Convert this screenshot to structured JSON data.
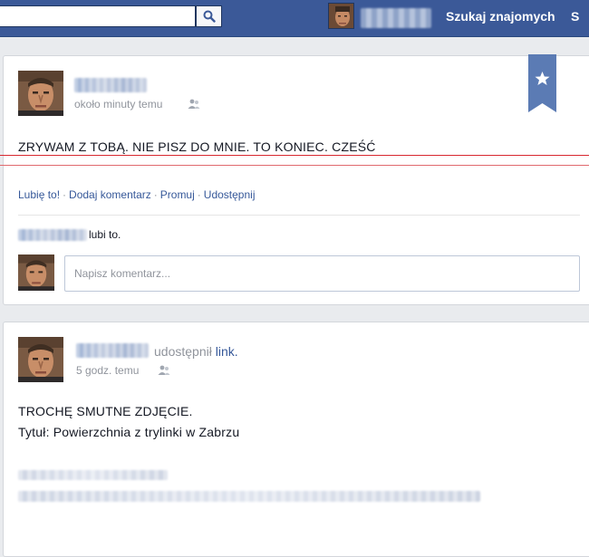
{
  "topbar": {
    "search": {
      "placeholder": "",
      "icon": "search-icon"
    },
    "find_friends_label": "Szukaj znajomych",
    "next_link_label": "S",
    "bg_color": "#3b5998"
  },
  "post1": {
    "time": "około minuty temu",
    "audience_icon": "friends-icon",
    "text": "ZRYWAM Z TOBĄ. NIE PISZ DO MNIE. TO KONIEC. CZEŚĆ",
    "actions": {
      "like": "Lubię to!",
      "comment": "Dodaj komentarz",
      "promote": "Promuj",
      "share": "Udostępnij",
      "separator": "·"
    },
    "likes_suffix": "lubi to.",
    "comment_placeholder": "Napisz komentarz...",
    "bookmark_icon": "star-icon"
  },
  "post2": {
    "shared_text": "udostępnił",
    "shared_link": "link.",
    "time": "5 godz. temu",
    "audience_icon": "friends-icon",
    "line1": "TROCHĘ SMUTNE ZDJĘCIE.",
    "line2": "Tytuł: Powierzchnia z trylinki w Zabrzu"
  },
  "colors": {
    "link": "#365899",
    "meta": "#90949c",
    "highlight_line": "#d7282f",
    "bookmark": "#5b7bb4"
  }
}
